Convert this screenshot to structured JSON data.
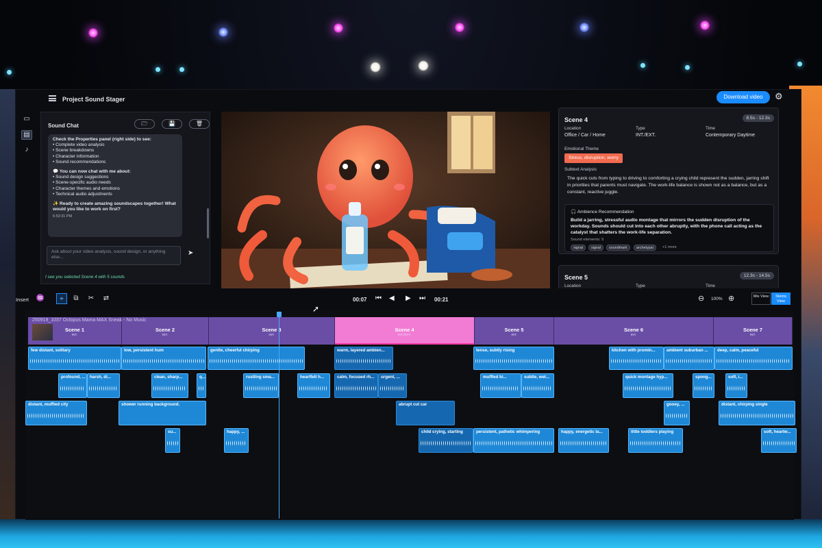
{
  "app": {
    "title": "Project Sound Stager",
    "download_label": "Download video"
  },
  "chat": {
    "title": "Sound Chat",
    "message": {
      "intro": "Check the Properties panel (right side) to see:",
      "list1": [
        "• Complete video analysis",
        "• Scene breakdowns",
        "• Character information",
        "• Sound recommendations"
      ],
      "chat_intro": "💬 You can now chat with me about:",
      "list2": [
        "• Sound design suggestions",
        "• Scene-specific audio needs",
        "• Character themes and emotions",
        "• Technical audio adjustments"
      ],
      "outro_bold": "✨ Ready to create amazing soundscapes together!",
      "outro": " What would you like to work on first?",
      "time": "6:53:31 PM"
    },
    "input_placeholder": "Ask about your video analysis, sound design, or anything else...",
    "status": "I see you selected Scene 4 with 5 sounds"
  },
  "properties": {
    "labels": {
      "location": "Location",
      "type": "Type",
      "time": "Time",
      "emotional_theme": "Emotional Theme",
      "subtext": "Subtext Analysis",
      "ambience": "Ambience Recommendation"
    },
    "scene4": {
      "name": "Scene 4",
      "range": "8.5s - 12.3s",
      "location": "Office / Car / Home",
      "type": "INT./EXT.",
      "time": "Contemporary Daytime",
      "emotion": "Stress, disruption, worry",
      "subtext": "The quick cuts from typing to driving to comforting a crying child represent the sudden, jarring shift in priorities that parents must navigate. The work-life balance is shown not as a balance, but as a constant, reactive juggle.",
      "ambience": "Build a jarring, stressful audio montage that mirrors the sudden disruption of the workday. Sounds should cut into each other abruptly, with the phone call acting as the catalyst that shatters the work-life separation.",
      "sound_count": "Sound elements: 5",
      "chips": [
        "signal",
        "signal",
        "soundmark",
        "archetypal"
      ],
      "more": "+1 more"
    },
    "scene5": {
      "name": "Scene 5",
      "range": "12.3s - 14.5s"
    }
  },
  "transport": {
    "insert_label": "Insert",
    "current_time": "00:07",
    "total_time": "00:21",
    "zoom": "100%",
    "mix_view": "Mix View",
    "stems_view": "Stems View"
  },
  "timeline": {
    "video_label": "250919_1037 Octopus Mama MAX Sneak - No Music",
    "scenes": [
      {
        "name": "Scene 1",
        "sub": "INT."
      },
      {
        "name": "Scene 2",
        "sub": "INT."
      },
      {
        "name": "Scene 3",
        "sub": "INT."
      },
      {
        "name": "Scene 4",
        "sub": "INT./EXT."
      },
      {
        "name": "Scene 5",
        "sub": "INT."
      },
      {
        "name": "Scene 6",
        "sub": "INT."
      },
      {
        "name": "Scene 7",
        "sub": "INT."
      }
    ],
    "clips": [
      "few distant, solitary",
      "low, persistent hum",
      "gentle, cheerful chirping",
      "warm, layered ambien...",
      "tense, subtly rising",
      "kitchen with promin...",
      "ambient suburban ...",
      "deep, calm, peaceful",
      "profound, ...",
      "harsh, di...",
      "clean, sharp...",
      "q...",
      "rustling sma...",
      "heartfelt h...",
      "calm, focused rh...",
      "urgent, ...",
      "muffled bi...",
      "subtle, wet...",
      "quick montage hyp...",
      "spong...",
      "soft, i...",
      "distant, muffled city",
      "shower running background.",
      "abrupt cut car",
      "gooey, ...",
      "distant, chirping single",
      "su...",
      "happy, ...",
      "child crying, starting",
      "persistent, pathetic whimpering",
      "happy, energetic la...",
      "little toddlers playing",
      "soft, heartw..."
    ]
  }
}
